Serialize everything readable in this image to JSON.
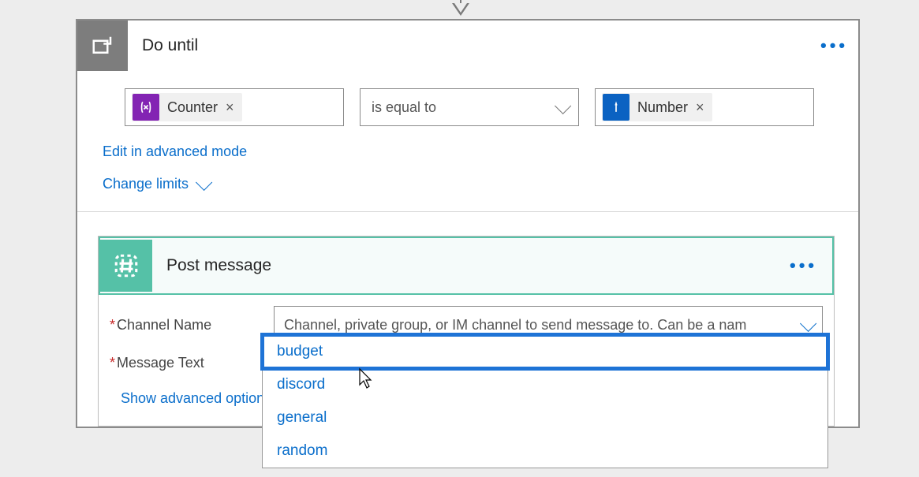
{
  "outer": {
    "title": "Do until",
    "menu_label": "more-options"
  },
  "condition": {
    "left_token": "Counter",
    "operator": "is equal to",
    "right_token": "Number",
    "remove_x": "×"
  },
  "links": {
    "advanced_mode": "Edit in advanced mode",
    "change_limits": "Change limits"
  },
  "action": {
    "title": "Post message",
    "fields": {
      "channel": {
        "label": "Channel Name",
        "placeholder": "Channel, private group, or IM channel to send message to. Can be a nam"
      },
      "message": {
        "label": "Message Text"
      }
    },
    "show_advanced": "Show advanced options"
  },
  "dropdown": {
    "items": [
      "budget",
      "discord",
      "general",
      "random"
    ],
    "highlighted_index": 0
  }
}
